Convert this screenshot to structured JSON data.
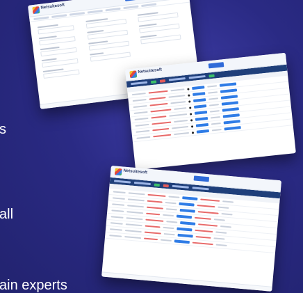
{
  "side_texts": [
    "s",
    "all",
    "ain experts"
  ],
  "cards": {
    "profile_card": {
      "brand": "Netsuitesoft",
      "footer": ""
    },
    "list_card": {
      "brand": "Netsuitesoft"
    },
    "table_card": {
      "brand": "Netsuitesoft"
    }
  },
  "colors": {
    "background": "#2a2a84",
    "accent_blue": "#2f6ad8",
    "status_red": "#e86a6a",
    "status_green": "#3cbf6a"
  }
}
